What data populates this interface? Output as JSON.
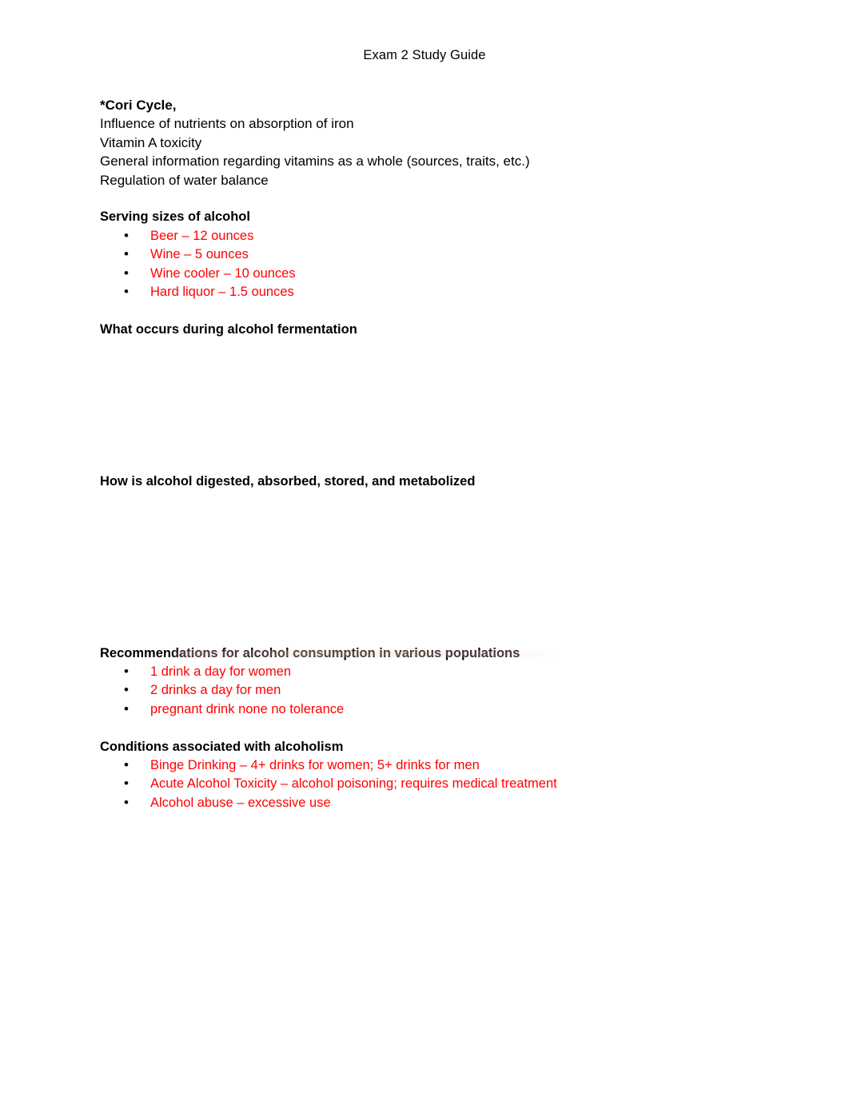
{
  "document": {
    "header": "Exam 2 Study Guide",
    "colors": {
      "text": "#000000",
      "highlight_red": "#FF0000",
      "page_background": "#FFFFFF"
    }
  },
  "topics": {
    "line_1": "*Cori Cycle,",
    "line_2": "Influence of nutrients on absorption of iron",
    "line_3": "Vitamin A toxicity",
    "line_4": "General information regarding vitamins as a whole (sources, traits, etc.)",
    "line_5": "Regulation of water balance"
  },
  "sections": [
    {
      "heading": "Serving sizes of alcohol",
      "bullets": [
        "Beer – 12 ounces",
        "Wine – 5 ounces",
        "Wine cooler – 10 ounces",
        "Hard liquor – 1.5 ounces"
      ]
    },
    {
      "heading": "What occurs during alcohol fermentation",
      "bullets": []
    },
    {
      "heading": "How is alcohol digested, absorbed, stored, and metabolized",
      "bullets": []
    },
    {
      "heading": "Recommendations for alcohol consumption in various populations",
      "bullets": [
        "1 drink a day for women",
        "2 drinks a day for men",
        "pregnant drink none no tolerance"
      ]
    },
    {
      "heading": "Conditions associated with alcoholism",
      "bullets": [
        "Binge Drinking – 4+ drinks for women; 5+ drinks for men",
        "Acute Alcohol Toxicity – alcohol poisoning; requires medical treatment",
        "Alcohol abuse – excessive use"
      ]
    }
  ]
}
